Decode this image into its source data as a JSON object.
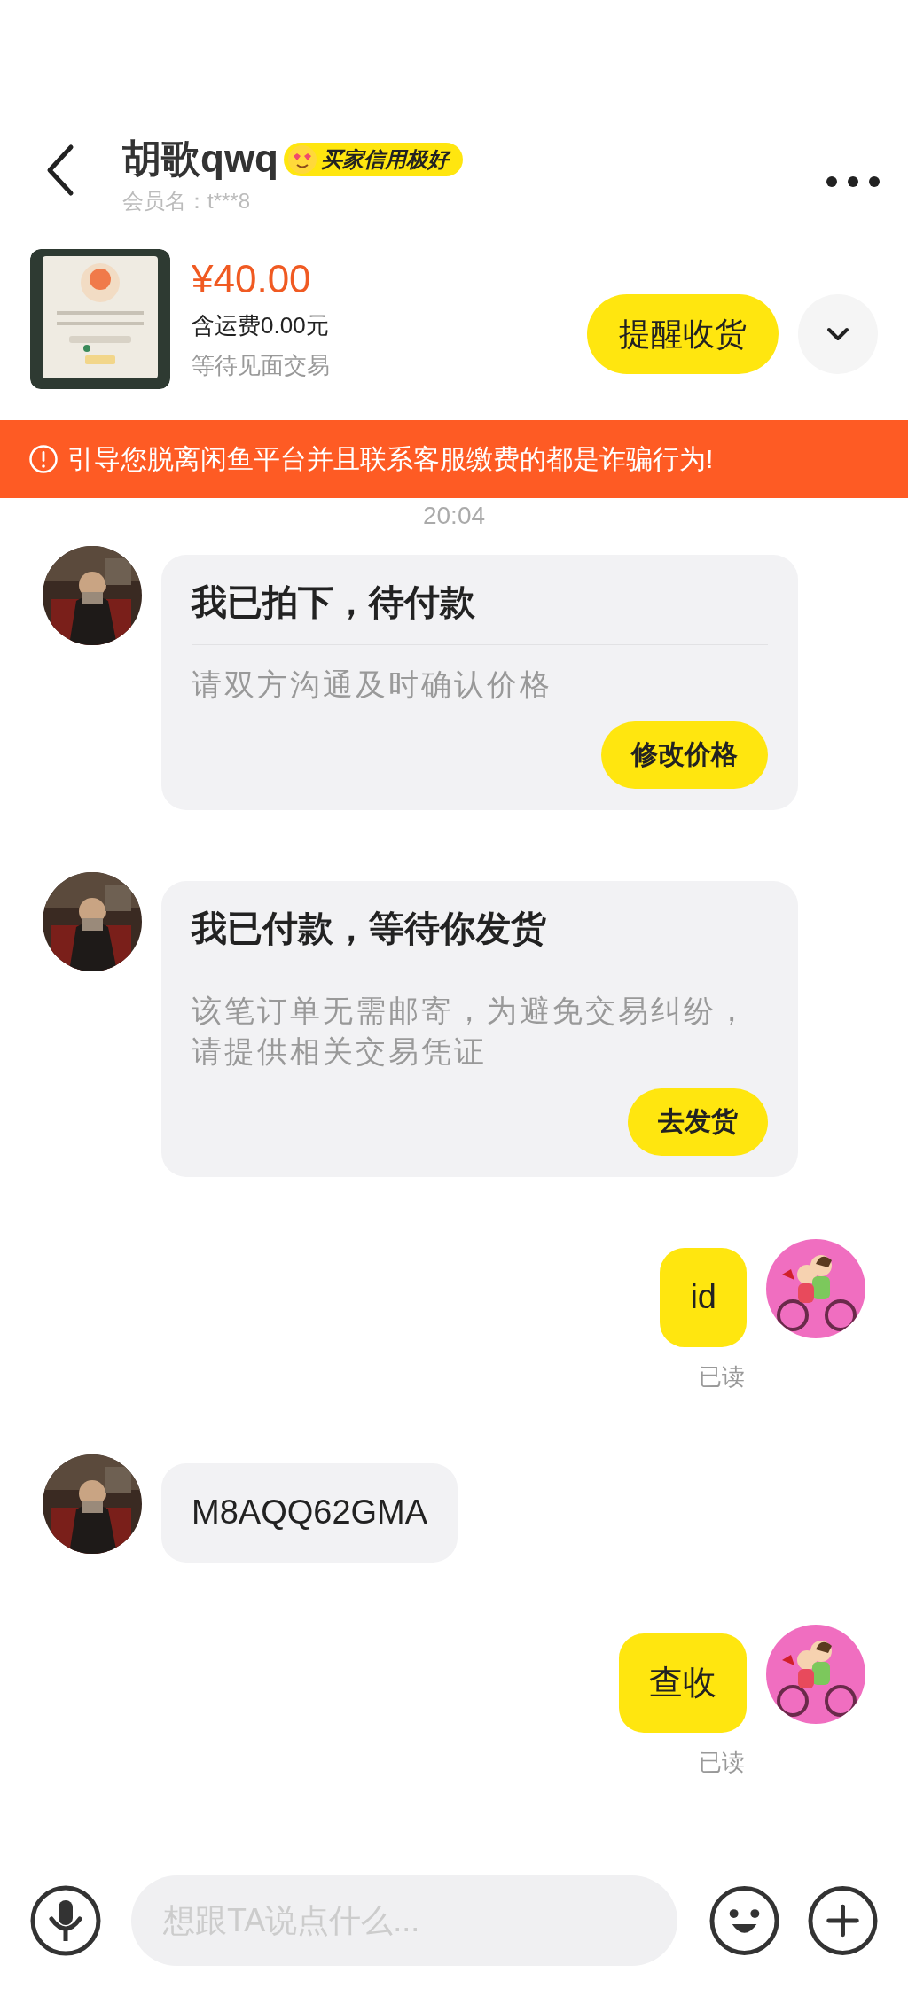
{
  "header": {
    "name": "胡歌qwq",
    "badge": "买家信用极好",
    "member": "会员名：t***8"
  },
  "product": {
    "price": "¥40.00",
    "shipping": "含运费0.00元",
    "status": "等待见面交易",
    "action": "提醒收货"
  },
  "warning": "引导您脱离闲鱼平台并且联系客服缴费的都是诈骗行为!",
  "time": "20:04",
  "messages": [
    {
      "kind": "card",
      "outgoing": false,
      "title": "我已拍下，待付款",
      "body": "请双方沟通及时确认价格",
      "button": "修改价格"
    },
    {
      "kind": "card",
      "outgoing": false,
      "title": "我已付款，等待你发货",
      "body": "该笔订单无需邮寄，为避免交易纠纷，请提供相关交易凭证",
      "button": "去发货"
    },
    {
      "kind": "text",
      "outgoing": true,
      "text": "id",
      "receipt": "已读"
    },
    {
      "kind": "text",
      "outgoing": false,
      "text": "M8AQQ62GMA"
    },
    {
      "kind": "text",
      "outgoing": true,
      "text": "查收",
      "receipt": "已读"
    }
  ],
  "input": {
    "placeholder": "想跟TA说点什么..."
  }
}
